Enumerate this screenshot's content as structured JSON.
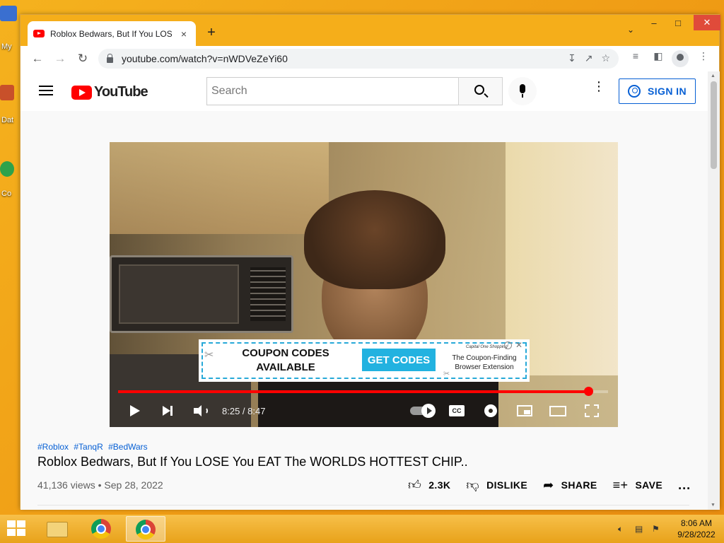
{
  "browser": {
    "tab_title": "Roblox Bedwars, But If You LOSE You EAT The WORLDS HOTTEST CHIP.. - YouTube",
    "tab_close": "×",
    "new_tab": "+",
    "url": "youtube.com/watch?v=nWDVeZeYi60"
  },
  "desktop": {
    "labels": [
      "My",
      "Dat",
      "Co"
    ]
  },
  "youtube": {
    "logo_text": "YouTube",
    "search_placeholder": "Search",
    "sign_in": "SIGN IN",
    "more": "⋮"
  },
  "ad": {
    "headline": "COUPON CODES AVAILABLE",
    "cta": "GET CODES",
    "brand": "Capital One Shopping",
    "tagline": "The Coupon-Finding Browser Extension"
  },
  "player": {
    "time": "8:25 / 8:47",
    "progress": 0.96,
    "cc_label": "CC"
  },
  "video": {
    "hashtags": [
      "#Roblox",
      "#TanqR",
      "#BedWars"
    ],
    "title": "Roblox Bedwars, But If You LOSE You EAT The WORLDS HOTTEST CHIP..",
    "views": "41,136 views • Sep 28, 2022",
    "likes": "2.3K",
    "dislike": "DISLIKE",
    "share": "SHARE",
    "save": "SAVE",
    "more": "..."
  },
  "taskbar": {
    "time": "8:06 AM",
    "date": "9/28/2022"
  },
  "colors": {
    "accent_blue": "#065fd4",
    "youtube_red": "#ff0000",
    "desktop_orange": "#f5ae1a"
  }
}
